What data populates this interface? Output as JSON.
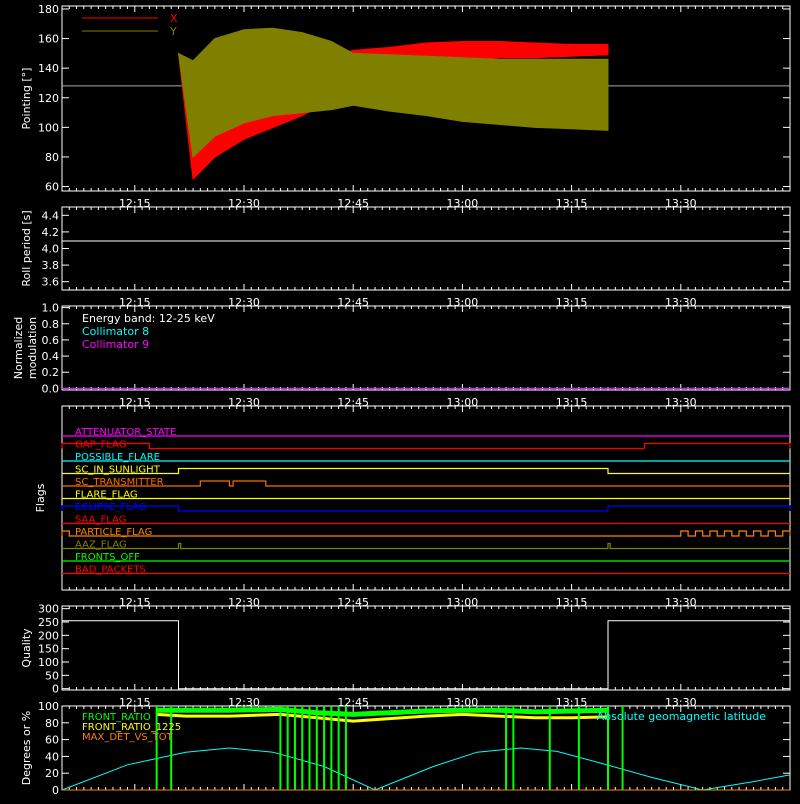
{
  "chart_data": [
    {
      "type": "line",
      "panel": "pointing",
      "ylabel": "Pointing [°]",
      "ylim": [
        57,
        182
      ],
      "yticks": [
        60,
        80,
        100,
        120,
        140,
        160,
        180
      ],
      "xlim": [
        "12:05",
        "13:45"
      ],
      "xticks": [
        "12:15",
        "12:30",
        "12:45",
        "13:00",
        "13:15",
        "13:30"
      ],
      "legend": [
        "X",
        "Y"
      ],
      "legend_colors": [
        "#ff0000",
        "#808000"
      ],
      "reference_line": 128,
      "series": [
        {
          "name": "X",
          "color": "#ff0000",
          "x": [
            "12:21",
            "12:23",
            "12:26",
            "12:30",
            "12:34",
            "12:38",
            "12:42",
            "12:45",
            "12:50",
            "12:55",
            "13:00",
            "13:05",
            "13:10",
            "13:15",
            "13:20"
          ],
          "upper": [
            150,
            130,
            138,
            140,
            142,
            145,
            148,
            152,
            154,
            157,
            158,
            158,
            157,
            156,
            156
          ],
          "lower": [
            150,
            65,
            80,
            92,
            100,
            108,
            118,
            130,
            138,
            144,
            146,
            147,
            147,
            148,
            149
          ]
        },
        {
          "name": "Y",
          "color": "#808000",
          "x": [
            "12:21",
            "12:23",
            "12:26",
            "12:30",
            "12:34",
            "12:38",
            "12:42",
            "12:45",
            "12:50",
            "12:55",
            "13:00",
            "13:05",
            "13:10",
            "13:15",
            "13:20"
          ],
          "upper": [
            150,
            145,
            160,
            166,
            167,
            164,
            158,
            150,
            149,
            148,
            147,
            146,
            146,
            146,
            146
          ],
          "lower": [
            150,
            80,
            94,
            103,
            108,
            110,
            112,
            115,
            111,
            108,
            104,
            102,
            100,
            99,
            98
          ]
        }
      ]
    },
    {
      "type": "line",
      "panel": "roll",
      "ylabel": "Roll period [s]",
      "ylim": [
        3.5,
        4.5
      ],
      "yticks": [
        3.6,
        3.8,
        4.0,
        4.2,
        4.4
      ],
      "xlim": [
        "12:05",
        "13:45"
      ],
      "xticks": [
        "12:15",
        "12:30",
        "12:45",
        "13:00",
        "13:15",
        "13:30"
      ],
      "series": [
        {
          "name": "",
          "color": "#ffffff",
          "x": [
            "12:05",
            "13:45"
          ],
          "y": [
            4.09,
            4.09
          ]
        }
      ]
    },
    {
      "type": "line",
      "panel": "modulation",
      "ylabel": "Normalized modulation",
      "ylim": [
        -0.02,
        1.02
      ],
      "yticks": [
        0.0,
        0.2,
        0.4,
        0.6,
        0.8,
        1.0
      ],
      "xlim": [
        "12:05",
        "13:45"
      ],
      "xticks": [
        "12:15",
        "12:30",
        "12:45",
        "13:00",
        "13:15",
        "13:30"
      ],
      "annotation": "Energy band: 12-25 keV",
      "legend": [
        "Collimator 8",
        "Collimator 9"
      ],
      "legend_colors": [
        "#00ffff",
        "#ff00ff"
      ],
      "series": [
        {
          "name": "Collimator 8",
          "color": "#00ffff",
          "x": [
            "12:05",
            "13:45"
          ],
          "y": [
            0.0,
            0.0
          ]
        },
        {
          "name": "Collimator 9",
          "color": "#ff00ff",
          "x": [
            "12:05",
            "13:45"
          ],
          "y": [
            0.0,
            0.0
          ]
        }
      ]
    },
    {
      "type": "line",
      "panel": "flags",
      "ylabel": "Flags",
      "xlim": [
        "12:05",
        "13:45"
      ],
      "xticks": [
        "12:15",
        "12:30",
        "12:45",
        "13:00",
        "13:15",
        "13:30"
      ],
      "flags": [
        {
          "name": "ATTENUATOR_STATE",
          "color": "#ff00ff",
          "high": []
        },
        {
          "name": "GAP_FLAG",
          "color": "#ff0000",
          "high": [
            [
              "12:05",
              "12:17"
            ],
            [
              "13:25",
              "13:45"
            ]
          ]
        },
        {
          "name": "POSSIBLE_FLARE",
          "color": "#00ffff",
          "high": []
        },
        {
          "name": "SC_IN_SUNLIGHT",
          "color": "#ffff00",
          "high": [
            [
              "12:21",
              "13:20"
            ]
          ]
        },
        {
          "name": "SC_TRANSMITTER",
          "color": "#ff6a00",
          "high": [
            [
              "12:24",
              "12:28"
            ],
            [
              "12:28.5",
              "12:33"
            ]
          ]
        },
        {
          "name": "FLARE_FLAG",
          "color": "#ffff00",
          "high": []
        },
        {
          "name": "ECLIPSE_FLAG",
          "color": "#0000ff",
          "high": [
            [
              "12:05",
              "12:21"
            ],
            [
              "13:20",
              "13:45"
            ]
          ]
        },
        {
          "name": "SAA_FLAG",
          "color": "#ff0000",
          "high": []
        },
        {
          "name": "PARTICLE_FLAG",
          "color": "#ff8000",
          "high": [
            [
              "12:05",
              "12:06"
            ],
            [
              "13:30",
              "13:31"
            ],
            [
              "13:32",
              "13:33"
            ],
            [
              "13:34",
              "13:35"
            ],
            [
              "13:36",
              "13:37"
            ],
            [
              "13:38",
              "13:39"
            ],
            [
              "13:40",
              "13:41"
            ],
            [
              "13:42",
              "13:43"
            ],
            [
              "13:44",
              "13:45"
            ]
          ]
        },
        {
          "name": "AAZ_FLAG",
          "color": "#808000",
          "high": [
            [
              "12:21",
              "12:21.3"
            ],
            [
              "13:20",
              "13:20.3"
            ]
          ]
        },
        {
          "name": "FRONTS_OFF",
          "color": "#00ff00",
          "high": []
        },
        {
          "name": "BAD_PACKETS",
          "color": "#ff0000",
          "high": []
        }
      ]
    },
    {
      "type": "line",
      "panel": "quality",
      "ylabel": "Quality",
      "ylim": [
        -5,
        310
      ],
      "yticks": [
        0,
        50,
        100,
        150,
        200,
        250,
        300
      ],
      "xlim": [
        "12:05",
        "13:45"
      ],
      "xticks": [
        "12:15",
        "12:30",
        "12:45",
        "13:00",
        "13:15",
        "13:30"
      ],
      "series": [
        {
          "name": "",
          "color": "#ffffff",
          "x": [
            "12:05",
            "12:21",
            "12:21",
            "13:20",
            "13:20",
            "13:45"
          ],
          "y": [
            255,
            255,
            0,
            0,
            255,
            255
          ]
        }
      ]
    },
    {
      "type": "line",
      "panel": "ratios",
      "ylabel": "Degrees or %",
      "ylim": [
        0,
        100
      ],
      "yticks": [
        0,
        20,
        40,
        60,
        80,
        100
      ],
      "xlim": [
        "12:05",
        "13:45"
      ],
      "xticks": [
        "12:15",
        "12:30",
        "12:45",
        "13:00",
        "13:15",
        "13:30"
      ],
      "legend": [
        "FRONT_RATIO",
        "FRONT_RATIO_1225",
        "MAX_DET_VS_TOT"
      ],
      "legend_colors": [
        "#00ff00",
        "#ffff00",
        "#ff8000"
      ],
      "annotation": "Absolute geomagnetic latitude",
      "annotation_color": "#00ffff",
      "series": [
        {
          "name": "Absolute geomagnetic latitude",
          "color": "#00ffff",
          "x": [
            "12:05",
            "12:14",
            "12:22",
            "12:28",
            "12:34",
            "12:41",
            "12:48",
            "12:56",
            "13:02",
            "13:08",
            "13:13",
            "13:19",
            "13:26",
            "13:33",
            "13:40",
            "13:45"
          ],
          "y": [
            0,
            30,
            45,
            50,
            45,
            28,
            0,
            28,
            45,
            50,
            46,
            32,
            15,
            0,
            10,
            18
          ]
        },
        {
          "name": "FRONT_RATIO_1225",
          "color": "#ffff00",
          "x": [
            "12:18",
            "12:22",
            "12:28",
            "12:35",
            "12:40",
            "12:45",
            "12:50",
            "12:55",
            "13:00",
            "13:05",
            "13:10",
            "13:15",
            "13:20"
          ],
          "y": [
            90,
            88,
            88,
            90,
            86,
            82,
            85,
            88,
            90,
            88,
            86,
            86,
            87
          ]
        },
        {
          "name": "FRONT_RATIO",
          "color": "#00ff00",
          "x": [
            "12:18",
            "12:22",
            "12:28",
            "12:35",
            "12:40",
            "12:45",
            "12:50",
            "12:55",
            "13:00",
            "13:05",
            "13:10",
            "13:15",
            "13:20"
          ],
          "y": [
            95,
            95,
            95,
            96,
            92,
            90,
            92,
            94,
            95,
            95,
            93,
            94,
            95
          ],
          "spikes": [
            "12:18",
            "12:20",
            "12:35",
            "12:36",
            "12:37",
            "12:38",
            "12:39",
            "12:40",
            "12:41",
            "12:42",
            "12:43",
            "12:44",
            "13:06",
            "13:07",
            "13:12",
            "13:16",
            "13:20",
            "13:22"
          ]
        },
        {
          "name": "MAX_DET_VS_TOT",
          "color": "#ff8000",
          "x": [
            "12:05",
            "13:45"
          ],
          "y": [
            0,
            0
          ]
        }
      ]
    }
  ]
}
